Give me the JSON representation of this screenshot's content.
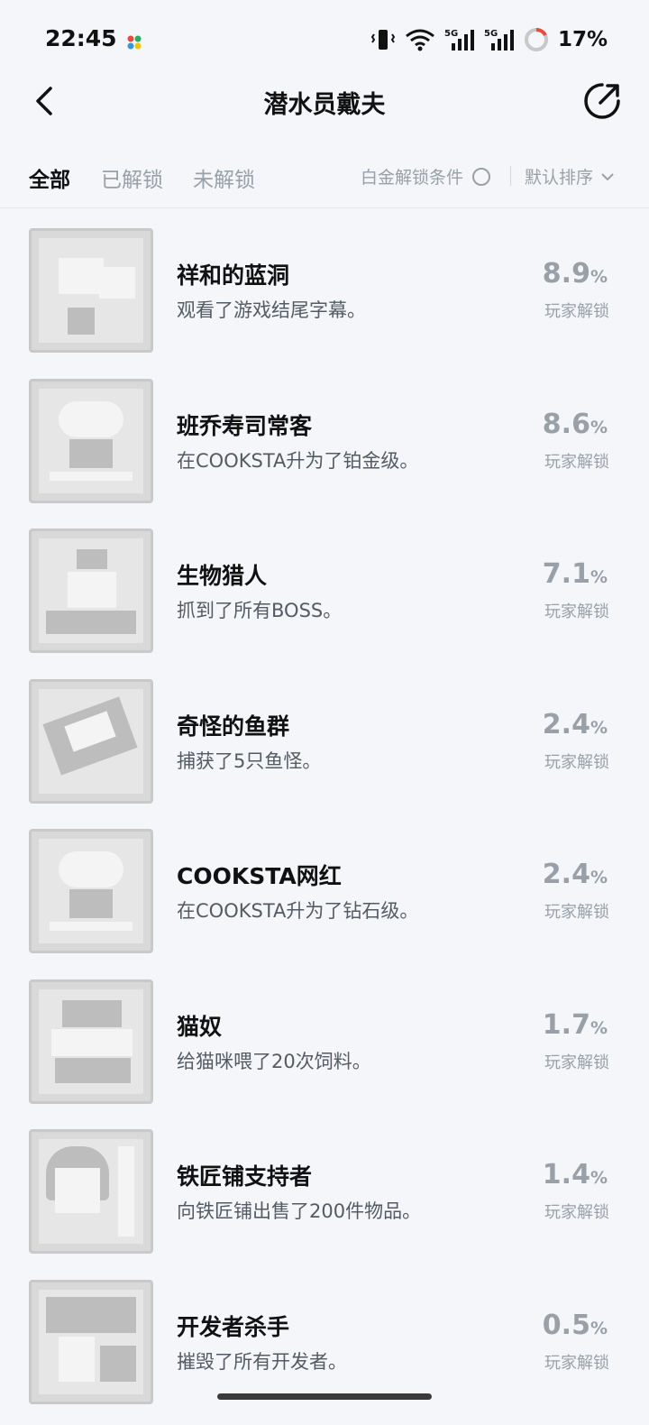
{
  "status": {
    "time": "22:45",
    "battery": "17%"
  },
  "header": {
    "title": "潜水员戴夫"
  },
  "filters": {
    "tabs": [
      "全部",
      "已解锁",
      "未解锁"
    ],
    "condition": "白金解锁条件",
    "sort": "默认排序"
  },
  "unlock_label": "玩家解锁",
  "items": [
    {
      "name": "祥和的蓝洞",
      "desc": "观看了游戏结尾字幕。",
      "pct": "8.9",
      "unit": "%"
    },
    {
      "name": "班乔寿司常客",
      "desc": "在COOKSTA升为了铂金级。",
      "pct": "8.6",
      "unit": "%"
    },
    {
      "name": "生物猎人",
      "desc": "抓到了所有BOSS。",
      "pct": "7.1",
      "unit": "%"
    },
    {
      "name": "奇怪的鱼群",
      "desc": "捕获了5只鱼怪。",
      "pct": "2.4",
      "unit": "%"
    },
    {
      "name": "COOKSTA网红",
      "desc": "在COOKSTA升为了钻石级。",
      "pct": "2.4",
      "unit": "%"
    },
    {
      "name": "猫奴",
      "desc": "给猫咪喂了20次饲料。",
      "pct": "1.7",
      "unit": "%"
    },
    {
      "name": "铁匠铺支持者",
      "desc": "向铁匠铺出售了200件物品。",
      "pct": "1.4",
      "unit": "%"
    },
    {
      "name": "开发者杀手",
      "desc": "摧毁了所有开发者。",
      "pct": "0.5",
      "unit": "%"
    }
  ]
}
